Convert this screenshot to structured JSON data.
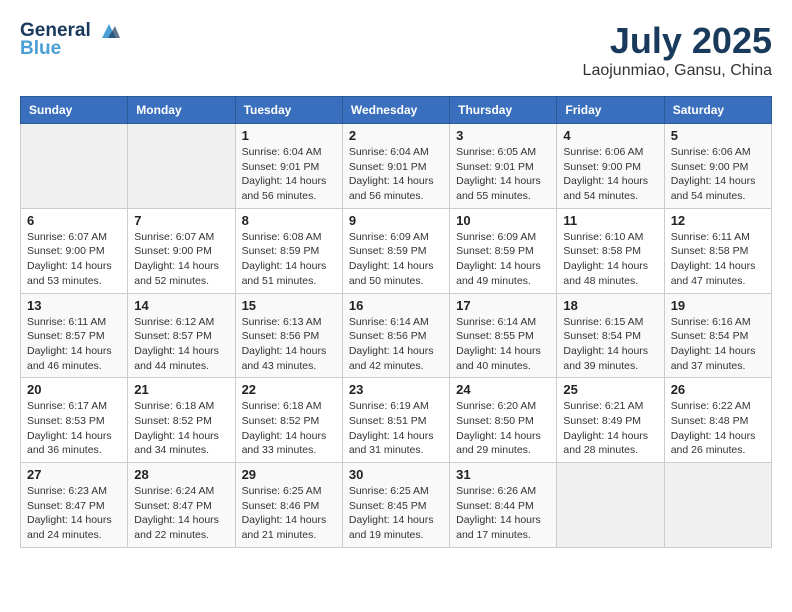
{
  "header": {
    "logo_line1": "General",
    "logo_line2": "Blue",
    "title": "July 2025",
    "subtitle": "Laojunmiao, Gansu, China"
  },
  "days_of_week": [
    "Sunday",
    "Monday",
    "Tuesday",
    "Wednesday",
    "Thursday",
    "Friday",
    "Saturday"
  ],
  "weeks": [
    [
      {
        "day": "",
        "sunrise": "",
        "sunset": "",
        "daylight": ""
      },
      {
        "day": "",
        "sunrise": "",
        "sunset": "",
        "daylight": ""
      },
      {
        "day": "1",
        "sunrise": "Sunrise: 6:04 AM",
        "sunset": "Sunset: 9:01 PM",
        "daylight": "Daylight: 14 hours and 56 minutes."
      },
      {
        "day": "2",
        "sunrise": "Sunrise: 6:04 AM",
        "sunset": "Sunset: 9:01 PM",
        "daylight": "Daylight: 14 hours and 56 minutes."
      },
      {
        "day": "3",
        "sunrise": "Sunrise: 6:05 AM",
        "sunset": "Sunset: 9:01 PM",
        "daylight": "Daylight: 14 hours and 55 minutes."
      },
      {
        "day": "4",
        "sunrise": "Sunrise: 6:06 AM",
        "sunset": "Sunset: 9:00 PM",
        "daylight": "Daylight: 14 hours and 54 minutes."
      },
      {
        "day": "5",
        "sunrise": "Sunrise: 6:06 AM",
        "sunset": "Sunset: 9:00 PM",
        "daylight": "Daylight: 14 hours and 54 minutes."
      }
    ],
    [
      {
        "day": "6",
        "sunrise": "Sunrise: 6:07 AM",
        "sunset": "Sunset: 9:00 PM",
        "daylight": "Daylight: 14 hours and 53 minutes."
      },
      {
        "day": "7",
        "sunrise": "Sunrise: 6:07 AM",
        "sunset": "Sunset: 9:00 PM",
        "daylight": "Daylight: 14 hours and 52 minutes."
      },
      {
        "day": "8",
        "sunrise": "Sunrise: 6:08 AM",
        "sunset": "Sunset: 8:59 PM",
        "daylight": "Daylight: 14 hours and 51 minutes."
      },
      {
        "day": "9",
        "sunrise": "Sunrise: 6:09 AM",
        "sunset": "Sunset: 8:59 PM",
        "daylight": "Daylight: 14 hours and 50 minutes."
      },
      {
        "day": "10",
        "sunrise": "Sunrise: 6:09 AM",
        "sunset": "Sunset: 8:59 PM",
        "daylight": "Daylight: 14 hours and 49 minutes."
      },
      {
        "day": "11",
        "sunrise": "Sunrise: 6:10 AM",
        "sunset": "Sunset: 8:58 PM",
        "daylight": "Daylight: 14 hours and 48 minutes."
      },
      {
        "day": "12",
        "sunrise": "Sunrise: 6:11 AM",
        "sunset": "Sunset: 8:58 PM",
        "daylight": "Daylight: 14 hours and 47 minutes."
      }
    ],
    [
      {
        "day": "13",
        "sunrise": "Sunrise: 6:11 AM",
        "sunset": "Sunset: 8:57 PM",
        "daylight": "Daylight: 14 hours and 46 minutes."
      },
      {
        "day": "14",
        "sunrise": "Sunrise: 6:12 AM",
        "sunset": "Sunset: 8:57 PM",
        "daylight": "Daylight: 14 hours and 44 minutes."
      },
      {
        "day": "15",
        "sunrise": "Sunrise: 6:13 AM",
        "sunset": "Sunset: 8:56 PM",
        "daylight": "Daylight: 14 hours and 43 minutes."
      },
      {
        "day": "16",
        "sunrise": "Sunrise: 6:14 AM",
        "sunset": "Sunset: 8:56 PM",
        "daylight": "Daylight: 14 hours and 42 minutes."
      },
      {
        "day": "17",
        "sunrise": "Sunrise: 6:14 AM",
        "sunset": "Sunset: 8:55 PM",
        "daylight": "Daylight: 14 hours and 40 minutes."
      },
      {
        "day": "18",
        "sunrise": "Sunrise: 6:15 AM",
        "sunset": "Sunset: 8:54 PM",
        "daylight": "Daylight: 14 hours and 39 minutes."
      },
      {
        "day": "19",
        "sunrise": "Sunrise: 6:16 AM",
        "sunset": "Sunset: 8:54 PM",
        "daylight": "Daylight: 14 hours and 37 minutes."
      }
    ],
    [
      {
        "day": "20",
        "sunrise": "Sunrise: 6:17 AM",
        "sunset": "Sunset: 8:53 PM",
        "daylight": "Daylight: 14 hours and 36 minutes."
      },
      {
        "day": "21",
        "sunrise": "Sunrise: 6:18 AM",
        "sunset": "Sunset: 8:52 PM",
        "daylight": "Daylight: 14 hours and 34 minutes."
      },
      {
        "day": "22",
        "sunrise": "Sunrise: 6:18 AM",
        "sunset": "Sunset: 8:52 PM",
        "daylight": "Daylight: 14 hours and 33 minutes."
      },
      {
        "day": "23",
        "sunrise": "Sunrise: 6:19 AM",
        "sunset": "Sunset: 8:51 PM",
        "daylight": "Daylight: 14 hours and 31 minutes."
      },
      {
        "day": "24",
        "sunrise": "Sunrise: 6:20 AM",
        "sunset": "Sunset: 8:50 PM",
        "daylight": "Daylight: 14 hours and 29 minutes."
      },
      {
        "day": "25",
        "sunrise": "Sunrise: 6:21 AM",
        "sunset": "Sunset: 8:49 PM",
        "daylight": "Daylight: 14 hours and 28 minutes."
      },
      {
        "day": "26",
        "sunrise": "Sunrise: 6:22 AM",
        "sunset": "Sunset: 8:48 PM",
        "daylight": "Daylight: 14 hours and 26 minutes."
      }
    ],
    [
      {
        "day": "27",
        "sunrise": "Sunrise: 6:23 AM",
        "sunset": "Sunset: 8:47 PM",
        "daylight": "Daylight: 14 hours and 24 minutes."
      },
      {
        "day": "28",
        "sunrise": "Sunrise: 6:24 AM",
        "sunset": "Sunset: 8:47 PM",
        "daylight": "Daylight: 14 hours and 22 minutes."
      },
      {
        "day": "29",
        "sunrise": "Sunrise: 6:25 AM",
        "sunset": "Sunset: 8:46 PM",
        "daylight": "Daylight: 14 hours and 21 minutes."
      },
      {
        "day": "30",
        "sunrise": "Sunrise: 6:25 AM",
        "sunset": "Sunset: 8:45 PM",
        "daylight": "Daylight: 14 hours and 19 minutes."
      },
      {
        "day": "31",
        "sunrise": "Sunrise: 6:26 AM",
        "sunset": "Sunset: 8:44 PM",
        "daylight": "Daylight: 14 hours and 17 minutes."
      },
      {
        "day": "",
        "sunrise": "",
        "sunset": "",
        "daylight": ""
      },
      {
        "day": "",
        "sunrise": "",
        "sunset": "",
        "daylight": ""
      }
    ]
  ]
}
